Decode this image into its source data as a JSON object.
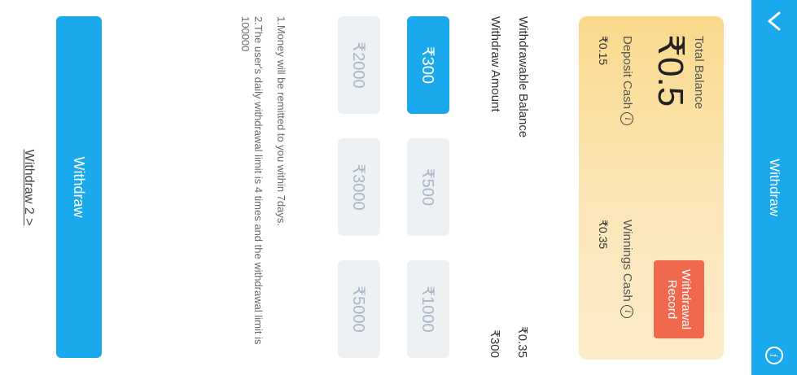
{
  "header": {
    "title": "Withdraw",
    "back_icon": "chevron-down-icon",
    "info_icon": "info-icon"
  },
  "card": {
    "total_label": "Total Balance",
    "total_value": "₹0.5",
    "deposit_label": "Deposit Cash",
    "deposit_value": "₹0.15",
    "winnings_label": "Winnings Cash",
    "winnings_value": "₹0.35",
    "record_button": "Withdrawal Record"
  },
  "info": {
    "withdrawable_label": "Withdrawable Balance",
    "withdrawable_value": "₹0.35",
    "amount_label": "Withdraw Amount",
    "amount_value": "₹300"
  },
  "options": [
    "₹300",
    "₹500",
    "₹1000",
    "₹2000",
    "₹3000",
    "₹5000"
  ],
  "selected_option": "₹300",
  "notes": [
    "1.Money will be remitted to you within 7days.",
    "2.The user's daily withdrawal limit is 4 times and the withdrawal limit is 100000"
  ],
  "withdraw_button": "Withdraw",
  "withdraw2_link": "Withdraw 2 >",
  "colors": {
    "accent": "#1aa9ec",
    "record": "#f2684e",
    "option_bg": "#eef1f4"
  }
}
